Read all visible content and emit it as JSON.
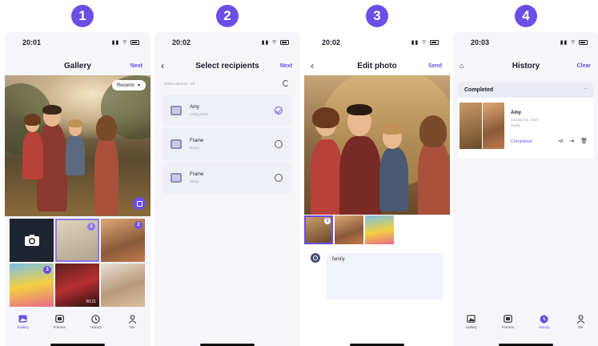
{
  "steps": [
    "1",
    "2",
    "3",
    "4"
  ],
  "gallery": {
    "time": "20:01",
    "title": "Gallery",
    "next_label": "Next",
    "recents_label": "Recents",
    "selected_counts": [
      "1",
      "2",
      "3"
    ],
    "video_duration": "00:21"
  },
  "select": {
    "time": "20:02",
    "title": "Select recipients",
    "next_label": "Next",
    "online_label": "Online devices: 1/3",
    "recipients": [
      {
        "name": "Amy",
        "sub": "Living room",
        "selected": true
      },
      {
        "name": "Frame",
        "sub": "Room",
        "selected": false
      },
      {
        "name": "Frame",
        "sub": "Study",
        "selected": false
      }
    ]
  },
  "edit": {
    "time": "20:02",
    "title": "Edit photo",
    "send_label": "Send",
    "strip_badge": "3",
    "caption": "family"
  },
  "history": {
    "time": "20:03",
    "title": "History",
    "clear_label": "Clear",
    "section_label": "Completed",
    "entry": {
      "name": "Amy",
      "date": "January 04, 2024",
      "tag": "family",
      "status": "Completed"
    }
  },
  "tabs": [
    "Gallery",
    "Frames",
    "History",
    "Me"
  ],
  "colors": {
    "accent": "#6c4ee6",
    "background": "#f5f5fa"
  }
}
